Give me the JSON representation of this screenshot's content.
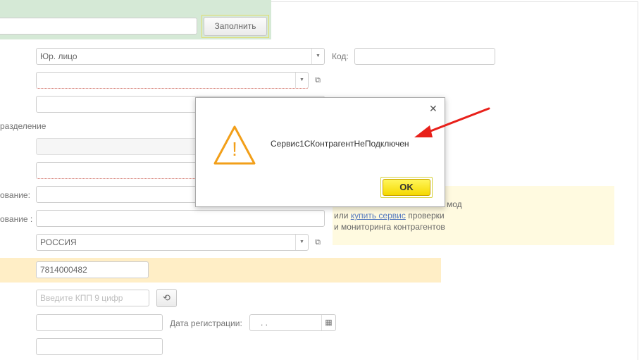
{
  "toolbar": {
    "fill_button_label": "Заполнить",
    "search_value": ""
  },
  "form": {
    "legal_form": "Юр. лицо",
    "code_label": "Код:",
    "code_value": "",
    "group_value": "",
    "name_value": "",
    "subdivision_label": "разделение",
    "subdivision_value": "",
    "subdivision2_value": "",
    "short_name_label": "ование:",
    "full_name_label": "ование :",
    "short_name_value": "",
    "full_name_value": "",
    "country_value": "РОССИЯ",
    "inn_value": "7814000482",
    "kpp_placeholder": "Введите КПП 9 цифр",
    "extra_value": "",
    "registration_date_label": "Дата регистрации:",
    "registration_date_value": ". .",
    "extra2_value": ""
  },
  "info_panel": {
    "line1_suffix": "мод",
    "line2_prefix": "или",
    "buy_service_link": "купить сервис",
    "line2_suffix": "проверки",
    "line3": "и мониторинга контрагентов"
  },
  "dialog": {
    "message": "Сервис1СКонтрагентНеПодключен",
    "ok_label": "OK",
    "close_glyph": "✕",
    "warning_glyph": "!"
  },
  "colors": {
    "green_header": "#c7e2c8",
    "orange_band": "#ffe8b3",
    "info_panel": "#fff8d6",
    "warning_orange": "#f29f19",
    "annotation_red": "#e8201a",
    "ok_yellow": "#f5d800",
    "link_blue": "#1f4ea8"
  },
  "icons": {
    "dropdown": "triangle-down-icon",
    "open": "open-window-icon",
    "history": "history-icon",
    "calendar": "calendar-icon",
    "warning": "warning-triangle-icon",
    "close": "close-icon",
    "arrow": "red-arrow-annotation"
  }
}
